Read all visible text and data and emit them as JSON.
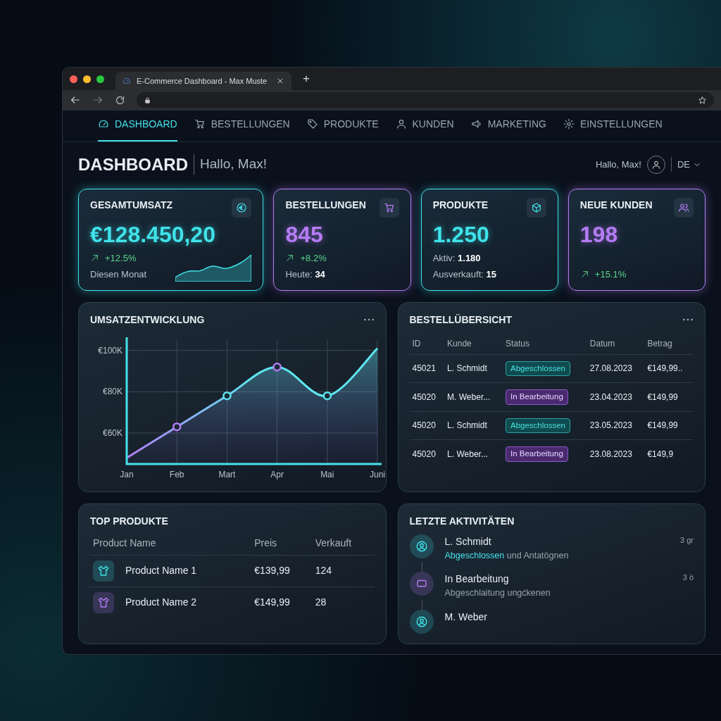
{
  "browser": {
    "tab_title": "E-Commerce Dashboard - Max Muste",
    "new_tab": "+"
  },
  "nav": [
    {
      "label": "DASHBOARD",
      "selected": true
    },
    {
      "label": "BESTELLUNGEN",
      "selected": false
    },
    {
      "label": "PRODUKTE",
      "selected": false
    },
    {
      "label": "KUNDEN",
      "selected": false
    },
    {
      "label": "MARKETING",
      "selected": false
    },
    {
      "label": "EINSTELLUNGEN",
      "selected": false
    }
  ],
  "header": {
    "title": "DASHBOARD",
    "greeting": "Hallo, Max!",
    "user_greeting": "Hallo, Max!",
    "language": "DE"
  },
  "kpis": [
    {
      "title": "GESAMTUMSATZ",
      "value": "€128.450,20",
      "change": "+12.5%",
      "color": "#3fe3ea",
      "sparkline": true,
      "details": [
        {
          "label": "Diesen Monat"
        }
      ]
    },
    {
      "title": "BESTELLUNGEN",
      "value": "845",
      "change": "+8.2%",
      "color": "#b57cf5",
      "details": [
        {
          "label": "Heute:",
          "value": "34"
        }
      ]
    },
    {
      "title": "PRODUKTE",
      "value": "1.250",
      "color": "#3fe3ea",
      "details": [
        {
          "label": "Aktiv:",
          "value": "1.180"
        },
        {
          "label": "Ausverkauft:",
          "value": "15"
        }
      ]
    },
    {
      "title": "NEUE KUNDEN",
      "value": "198",
      "change": "+15.1%",
      "color": "#b57cf5"
    }
  ],
  "revenue": {
    "chart_data": {
      "type": "area",
      "title": "UMSATZENTWICKLUNG",
      "categories": [
        "Jan",
        "Feb",
        "Mart",
        "Apr",
        "Mai",
        "Juni"
      ],
      "grid": true,
      "series": [
        {
          "color": "#5ee6f0",
          "values": [
            48000,
            63000,
            78000,
            92000,
            78000,
            101000
          ]
        }
      ],
      "ylim": [
        45000,
        105000
      ],
      "yticks": [
        {
          "value": 60000,
          "label": "€60K"
        },
        {
          "value": 80000,
          "label": "€80K"
        },
        {
          "value": 100000,
          "label": "€100K"
        }
      ]
    }
  },
  "orders": {
    "title": "BESTELLÜBERSICHT",
    "columns": [
      "ID",
      "Kunde",
      "Status",
      "Datum",
      "Betrag"
    ],
    "rows": [
      {
        "id": "45021",
        "customer": "L. Schmidt",
        "status": {
          "label": "Abgeschlossen",
          "kind": "done"
        },
        "date": "27.08.2023",
        "amount": "€149,99.."
      },
      {
        "id": "45020",
        "customer": "M. Weber...",
        "status": {
          "label": "In Bearbeitung",
          "kind": "progress"
        },
        "date": "23.04.2023",
        "amount": "€149,99"
      },
      {
        "id": "45020",
        "customer": "L. Schmidt",
        "status": {
          "label": "Abgeschlossen",
          "kind": "done"
        },
        "date": "23.05.2023",
        "amount": "€149,99"
      },
      {
        "id": "45020",
        "customer": "L. Weber...",
        "status": {
          "label": "In Bearbeitung",
          "kind": "progress"
        },
        "date": "23.08.2023",
        "amount": "€149,9"
      }
    ]
  },
  "top_products": {
    "title": "TOP PRODUKTE",
    "columns": [
      "Product Name",
      "Preis",
      "Verkauft"
    ],
    "rows": [
      {
        "name": "Product Name 1",
        "price": "€139,99",
        "sold": "124",
        "color": "#3fe3ea"
      },
      {
        "name": "Product Name 2",
        "price": "€149,99",
        "sold": "28",
        "color": "#b57cf5"
      }
    ]
  },
  "activities": {
    "title": "LETZTE AKTIVITÄTEN",
    "items": [
      {
        "color": "#3fe3ea",
        "name": "L. Schmidt",
        "highlight": "Abgeschlossen",
        "detail": "und Antatögnen",
        "time": "3 gr"
      },
      {
        "color": "#b57cf5",
        "name": "In Bearbeitung",
        "detail": "Abgeschlaitung ungćkenen",
        "time": "3 ö"
      },
      {
        "color": "#3fe3ea",
        "name": "M. Weber"
      }
    ]
  }
}
